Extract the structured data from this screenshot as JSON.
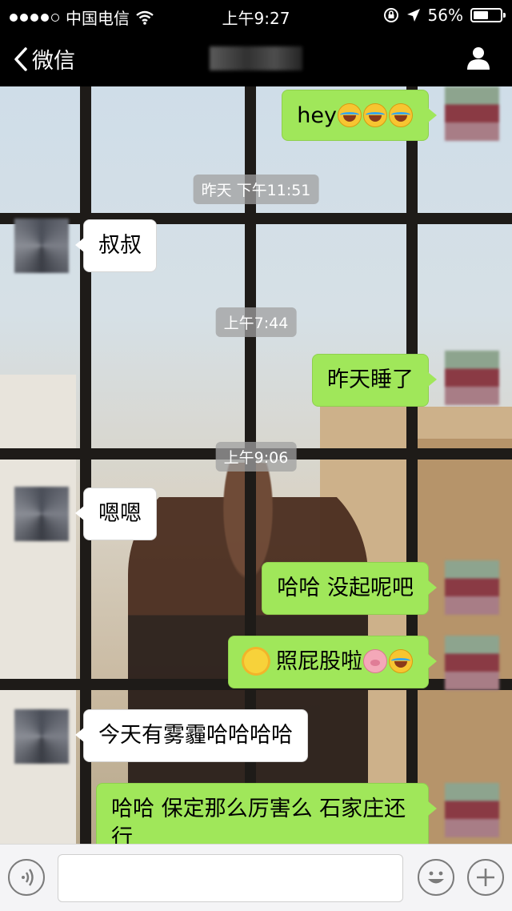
{
  "status_bar": {
    "carrier": "中国电信",
    "time": "上午9:27",
    "battery_percent": "56%",
    "battery_level": 0.56
  },
  "nav": {
    "back_label": "微信"
  },
  "messages": [
    {
      "type": "out",
      "text": "hey",
      "emojis": [
        "laugh",
        "laugh",
        "laugh"
      ]
    },
    {
      "type": "timestamp",
      "text": "昨天 下午11:51"
    },
    {
      "type": "in",
      "text": "叔叔"
    },
    {
      "type": "timestamp",
      "text": "上午7:44"
    },
    {
      "type": "out",
      "text": "昨天睡了"
    },
    {
      "type": "timestamp",
      "text": "上午9:06"
    },
    {
      "type": "in",
      "text": "嗯嗯"
    },
    {
      "type": "out",
      "text": "哈哈 没起呢吧"
    },
    {
      "type": "out",
      "text": "照屁股啦",
      "emojis": [
        "sun",
        "pig",
        "laugh"
      ]
    },
    {
      "type": "in",
      "text": "今天有雾霾哈哈哈哈"
    },
    {
      "type": "out",
      "text": "哈哈  保定那么厉害么 石家庄还行"
    }
  ],
  "input_bar": {
    "voice_icon": "voice-icon",
    "emoji_icon": "emoji-icon",
    "plus_icon": "plus-icon",
    "text_value": ""
  },
  "colors": {
    "outgoing_bubble": "#a0e75a",
    "incoming_bubble": "#ffffff",
    "bar_background": "#000000"
  }
}
